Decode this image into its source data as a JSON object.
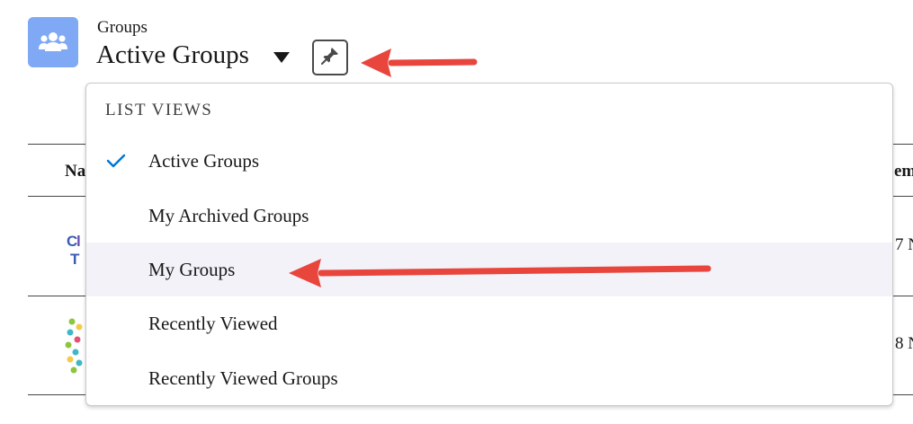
{
  "header": {
    "object_label": "Groups",
    "list_view_title": "Active Groups",
    "icon": "groups-icon",
    "icon_color": "#7fa8f5",
    "pin_icon": "pin-icon"
  },
  "table": {
    "col_left_partial": "Na",
    "col_right_partial": "em",
    "rows": [
      {
        "right_partial": "7 N"
      },
      {
        "right_partial": "8 N"
      }
    ]
  },
  "dropdown": {
    "heading": "LIST VIEWS",
    "items": [
      {
        "label": "Active Groups",
        "selected": true
      },
      {
        "label": "My Archived Groups",
        "selected": false
      },
      {
        "label": "My Groups",
        "selected": false,
        "highlighted": true
      },
      {
        "label": "Recently Viewed",
        "selected": false
      },
      {
        "label": "Recently Viewed Groups",
        "selected": false
      }
    ]
  },
  "colors": {
    "annotation_arrow": "#e8453c",
    "check": "#0176d3",
    "highlight_row": "#f3f2f9"
  }
}
